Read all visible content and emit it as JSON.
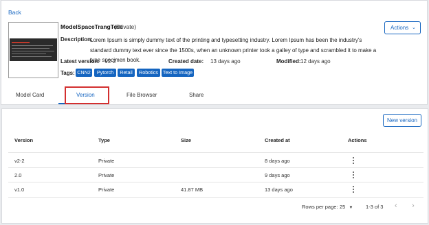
{
  "nav": {
    "back_label": "Back"
  },
  "model": {
    "name": "ModelSpaceTrangTest",
    "visibility": "(Private)",
    "description_label": "Description:",
    "description_text": "Lorem Ipsum is simply dummy text of the printing and typesetting industry. Lorem Ipsum has been the industry's standard dummy text ever since the 1500s, when an unknown printer took a galley of type and scrambled it to make a type specimen book.",
    "latest_version_label": "Latest version:",
    "latest_version_value": "v2-2",
    "created_label": "Created date:",
    "created_value": "13 days ago",
    "modified_label": "Modified:",
    "modified_value": "12 days ago",
    "tags_label": "Tags:",
    "tags": [
      "CNN2",
      "Pytorch",
      "Retail",
      "Robotics",
      "Text to Image"
    ],
    "actions_label": "Actions",
    "actions_icon": "chevron-down-icon"
  },
  "tabs": [
    {
      "label": "Model Card"
    },
    {
      "label": "Version"
    },
    {
      "label": "File Browser"
    },
    {
      "label": "Share"
    }
  ],
  "active_tab": "Version",
  "versions": {
    "new_version_label": "New version",
    "columns": [
      "Version",
      "Type",
      "Size",
      "Created at",
      "Actions"
    ],
    "rows": [
      {
        "version": "v2-2",
        "type": "Private",
        "size": "",
        "created_at": "8 days ago"
      },
      {
        "version": "2.0",
        "type": "Private",
        "size": "",
        "created_at": "9 days ago"
      },
      {
        "version": "v1.0",
        "type": "Private",
        "size": "41.87 MB",
        "created_at": "13 days ago"
      }
    ],
    "pagination": {
      "rows_per_page_label": "Rows per page:",
      "rows_per_page_value": "25",
      "range_label": "1-3 of 3"
    }
  },
  "colors": {
    "accent": "#1565c0",
    "highlight": "#d32f2f"
  }
}
